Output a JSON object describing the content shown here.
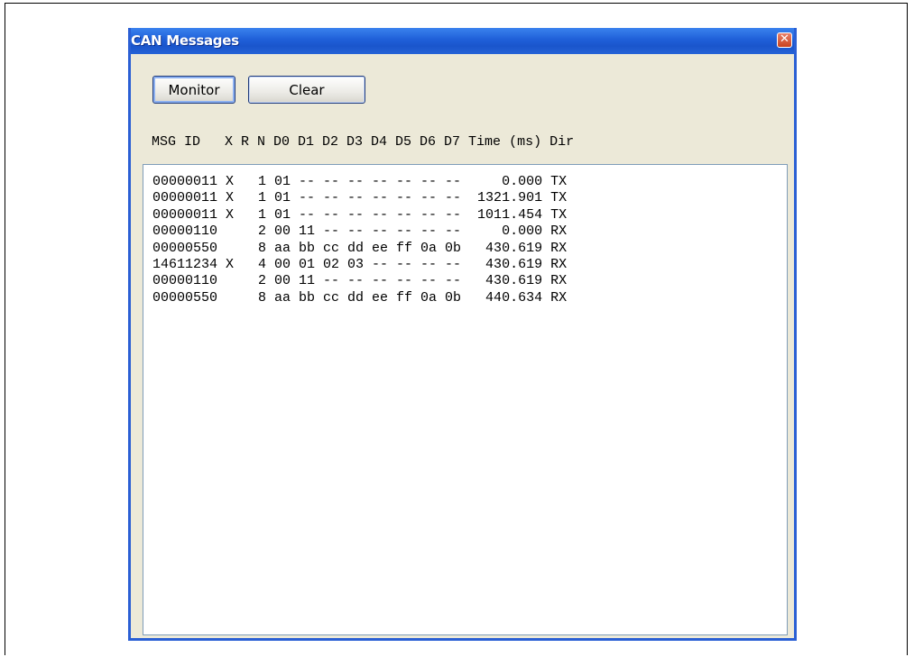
{
  "window": {
    "title": "CAN Messages",
    "close_glyph": "✕"
  },
  "toolbar": {
    "monitor_label": "Monitor",
    "clear_label": "Clear"
  },
  "table": {
    "header": "MSG ID   X R N D0 D1 D2 D3 D4 D5 D6 D7 Time (ms) Dir",
    "rows": [
      "00000011 X   1 01 -- -- -- -- -- -- --     0.000 TX",
      "00000011 X   1 01 -- -- -- -- -- -- --  1321.901 TX",
      "00000011 X   1 01 -- -- -- -- -- -- --  1011.454 TX",
      "00000110     2 00 11 -- -- -- -- -- --     0.000 RX",
      "00000550     8 aa bb cc dd ee ff 0a 0b   430.619 RX",
      "14611234 X   4 00 01 02 03 -- -- -- --   430.619 RX",
      "00000110     2 00 11 -- -- -- -- -- --   430.619 RX",
      "00000550     8 aa bb cc dd ee ff 0a 0b   440.634 RX"
    ]
  },
  "colors": {
    "titlebar": "#1f5fd8",
    "window_bg": "#ece9d8",
    "listbox_border": "#7f9db9"
  }
}
